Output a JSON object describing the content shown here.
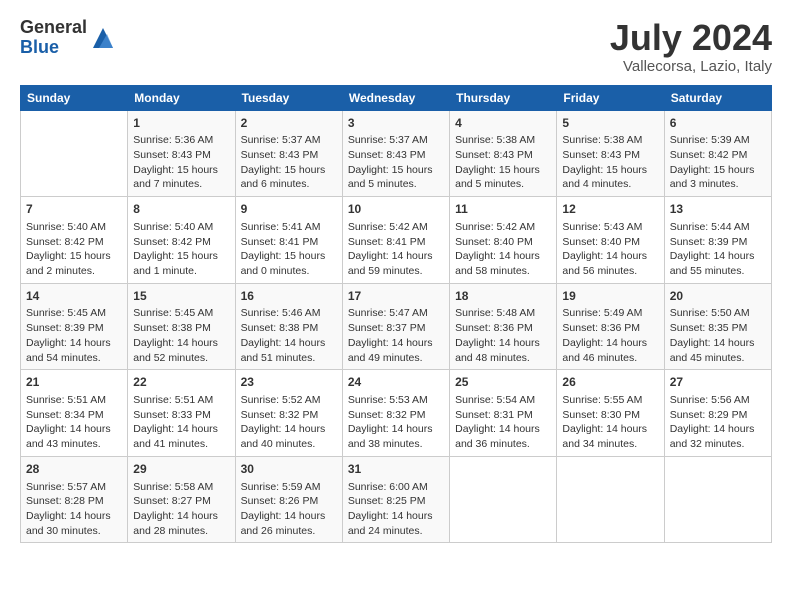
{
  "header": {
    "logo_general": "General",
    "logo_blue": "Blue",
    "month_title": "July 2024",
    "location": "Vallecorsa, Lazio, Italy"
  },
  "days_of_week": [
    "Sunday",
    "Monday",
    "Tuesday",
    "Wednesday",
    "Thursday",
    "Friday",
    "Saturday"
  ],
  "weeks": [
    [
      {
        "day": "",
        "info": ""
      },
      {
        "day": "1",
        "info": "Sunrise: 5:36 AM\nSunset: 8:43 PM\nDaylight: 15 hours\nand 7 minutes."
      },
      {
        "day": "2",
        "info": "Sunrise: 5:37 AM\nSunset: 8:43 PM\nDaylight: 15 hours\nand 6 minutes."
      },
      {
        "day": "3",
        "info": "Sunrise: 5:37 AM\nSunset: 8:43 PM\nDaylight: 15 hours\nand 5 minutes."
      },
      {
        "day": "4",
        "info": "Sunrise: 5:38 AM\nSunset: 8:43 PM\nDaylight: 15 hours\nand 5 minutes."
      },
      {
        "day": "5",
        "info": "Sunrise: 5:38 AM\nSunset: 8:43 PM\nDaylight: 15 hours\nand 4 minutes."
      },
      {
        "day": "6",
        "info": "Sunrise: 5:39 AM\nSunset: 8:42 PM\nDaylight: 15 hours\nand 3 minutes."
      }
    ],
    [
      {
        "day": "7",
        "info": "Sunrise: 5:40 AM\nSunset: 8:42 PM\nDaylight: 15 hours\nand 2 minutes."
      },
      {
        "day": "8",
        "info": "Sunrise: 5:40 AM\nSunset: 8:42 PM\nDaylight: 15 hours\nand 1 minute."
      },
      {
        "day": "9",
        "info": "Sunrise: 5:41 AM\nSunset: 8:41 PM\nDaylight: 15 hours\nand 0 minutes."
      },
      {
        "day": "10",
        "info": "Sunrise: 5:42 AM\nSunset: 8:41 PM\nDaylight: 14 hours\nand 59 minutes."
      },
      {
        "day": "11",
        "info": "Sunrise: 5:42 AM\nSunset: 8:40 PM\nDaylight: 14 hours\nand 58 minutes."
      },
      {
        "day": "12",
        "info": "Sunrise: 5:43 AM\nSunset: 8:40 PM\nDaylight: 14 hours\nand 56 minutes."
      },
      {
        "day": "13",
        "info": "Sunrise: 5:44 AM\nSunset: 8:39 PM\nDaylight: 14 hours\nand 55 minutes."
      }
    ],
    [
      {
        "day": "14",
        "info": "Sunrise: 5:45 AM\nSunset: 8:39 PM\nDaylight: 14 hours\nand 54 minutes."
      },
      {
        "day": "15",
        "info": "Sunrise: 5:45 AM\nSunset: 8:38 PM\nDaylight: 14 hours\nand 52 minutes."
      },
      {
        "day": "16",
        "info": "Sunrise: 5:46 AM\nSunset: 8:38 PM\nDaylight: 14 hours\nand 51 minutes."
      },
      {
        "day": "17",
        "info": "Sunrise: 5:47 AM\nSunset: 8:37 PM\nDaylight: 14 hours\nand 49 minutes."
      },
      {
        "day": "18",
        "info": "Sunrise: 5:48 AM\nSunset: 8:36 PM\nDaylight: 14 hours\nand 48 minutes."
      },
      {
        "day": "19",
        "info": "Sunrise: 5:49 AM\nSunset: 8:36 PM\nDaylight: 14 hours\nand 46 minutes."
      },
      {
        "day": "20",
        "info": "Sunrise: 5:50 AM\nSunset: 8:35 PM\nDaylight: 14 hours\nand 45 minutes."
      }
    ],
    [
      {
        "day": "21",
        "info": "Sunrise: 5:51 AM\nSunset: 8:34 PM\nDaylight: 14 hours\nand 43 minutes."
      },
      {
        "day": "22",
        "info": "Sunrise: 5:51 AM\nSunset: 8:33 PM\nDaylight: 14 hours\nand 41 minutes."
      },
      {
        "day": "23",
        "info": "Sunrise: 5:52 AM\nSunset: 8:32 PM\nDaylight: 14 hours\nand 40 minutes."
      },
      {
        "day": "24",
        "info": "Sunrise: 5:53 AM\nSunset: 8:32 PM\nDaylight: 14 hours\nand 38 minutes."
      },
      {
        "day": "25",
        "info": "Sunrise: 5:54 AM\nSunset: 8:31 PM\nDaylight: 14 hours\nand 36 minutes."
      },
      {
        "day": "26",
        "info": "Sunrise: 5:55 AM\nSunset: 8:30 PM\nDaylight: 14 hours\nand 34 minutes."
      },
      {
        "day": "27",
        "info": "Sunrise: 5:56 AM\nSunset: 8:29 PM\nDaylight: 14 hours\nand 32 minutes."
      }
    ],
    [
      {
        "day": "28",
        "info": "Sunrise: 5:57 AM\nSunset: 8:28 PM\nDaylight: 14 hours\nand 30 minutes."
      },
      {
        "day": "29",
        "info": "Sunrise: 5:58 AM\nSunset: 8:27 PM\nDaylight: 14 hours\nand 28 minutes."
      },
      {
        "day": "30",
        "info": "Sunrise: 5:59 AM\nSunset: 8:26 PM\nDaylight: 14 hours\nand 26 minutes."
      },
      {
        "day": "31",
        "info": "Sunrise: 6:00 AM\nSunset: 8:25 PM\nDaylight: 14 hours\nand 24 minutes."
      },
      {
        "day": "",
        "info": ""
      },
      {
        "day": "",
        "info": ""
      },
      {
        "day": "",
        "info": ""
      }
    ]
  ]
}
